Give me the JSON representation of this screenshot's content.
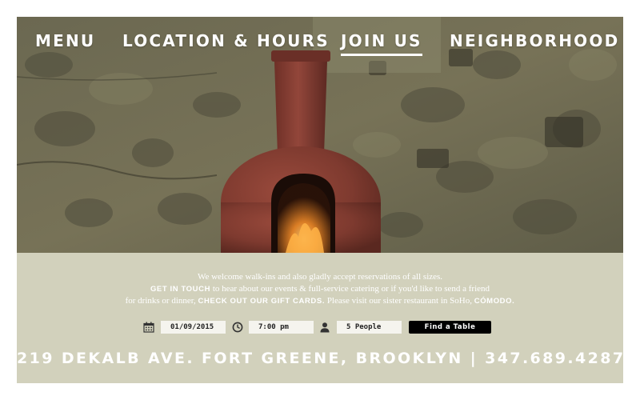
{
  "nav": {
    "items": [
      {
        "label": "MENU",
        "active": false
      },
      {
        "label": "LOCATION & HOURS",
        "active": false
      },
      {
        "label": "JOIN US",
        "active": true
      },
      {
        "label": "NEIGHBORHOOD",
        "active": false
      }
    ]
  },
  "info": {
    "line1": "We welcome walk-ins and also gladly accept reservations of all sizes.",
    "line2_link": "GET IN TOUCH",
    "line2_text": " to hear about our events & full-service catering or if you'd like to send a friend",
    "line3_text_a": "for drinks or dinner, ",
    "line3_link": "CHECK OUT OUR GIFT CARDS.",
    "line3_text_b": " Please visit our sister restaurant in SoHo, ",
    "line3_link2": "CÓMODO."
  },
  "reservation": {
    "date_value": "01/09/2015",
    "time_value": "7:00 pm",
    "party_value": "5 People",
    "button_label": "Find a Table",
    "icons": [
      "calendar-icon",
      "clock-icon",
      "person-icon"
    ]
  },
  "footer": {
    "address": "219 DEKALB AVE. FORT GREENE, BROOKLYN | 347.689.4287"
  },
  "colors": {
    "panel": "#d2d1bc",
    "text": "#ffffff",
    "button": "#000000",
    "field": "#f5f4ee"
  }
}
